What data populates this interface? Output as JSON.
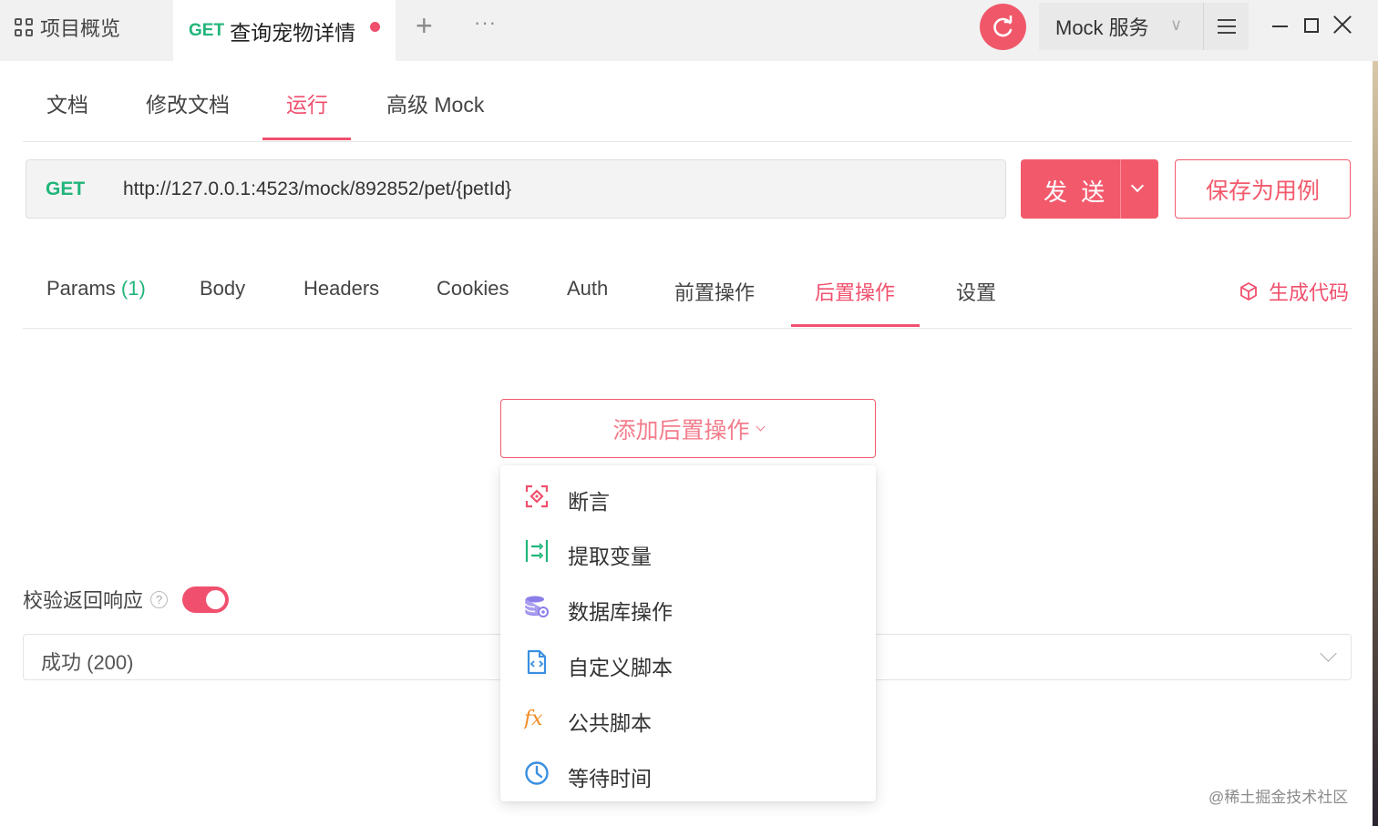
{
  "topbar": {
    "overview_label": "项目概览",
    "active_tab": {
      "method": "GET",
      "title": "查询宠物详情"
    },
    "new_tab_label": "+",
    "more_label": "···",
    "mock_select": {
      "value": "Mock 服务"
    }
  },
  "doc_tabs": [
    "文档",
    "修改文档",
    "运行",
    "高级 Mock"
  ],
  "request": {
    "method": "GET",
    "url": "http://127.0.0.1:4523/mock/892852/pet/{petId}",
    "send_label": "发 送",
    "save_label": "保存为用例"
  },
  "req_tabs": {
    "params_label": "Params",
    "params_count": "(1)",
    "body": "Body",
    "headers": "Headers",
    "cookies": "Cookies",
    "auth": "Auth",
    "pre_ops": "前置操作",
    "post_ops": "后置操作",
    "settings": "设置",
    "gen_code": "生成代码"
  },
  "add_post_op_label": "添加后置操作",
  "menu_items": [
    {
      "label": "断言",
      "icon": "assertion-icon"
    },
    {
      "label": "提取变量",
      "icon": "extract-variable-icon"
    },
    {
      "label": "数据库操作",
      "icon": "database-icon"
    },
    {
      "label": "自定义脚本",
      "icon": "script-file-icon"
    },
    {
      "label": "公共脚本",
      "icon": "fx-icon"
    },
    {
      "label": "等待时间",
      "icon": "clock-icon"
    }
  ],
  "validate": {
    "label": "校验返回响应",
    "help": "?",
    "enabled": true
  },
  "response_select": {
    "value": "成功 (200)"
  },
  "watermark": "@稀土掘金技术社区",
  "colors": {
    "accent": "#f0506e",
    "get_green": "#21b57a",
    "send_button": "#f25a6c"
  }
}
